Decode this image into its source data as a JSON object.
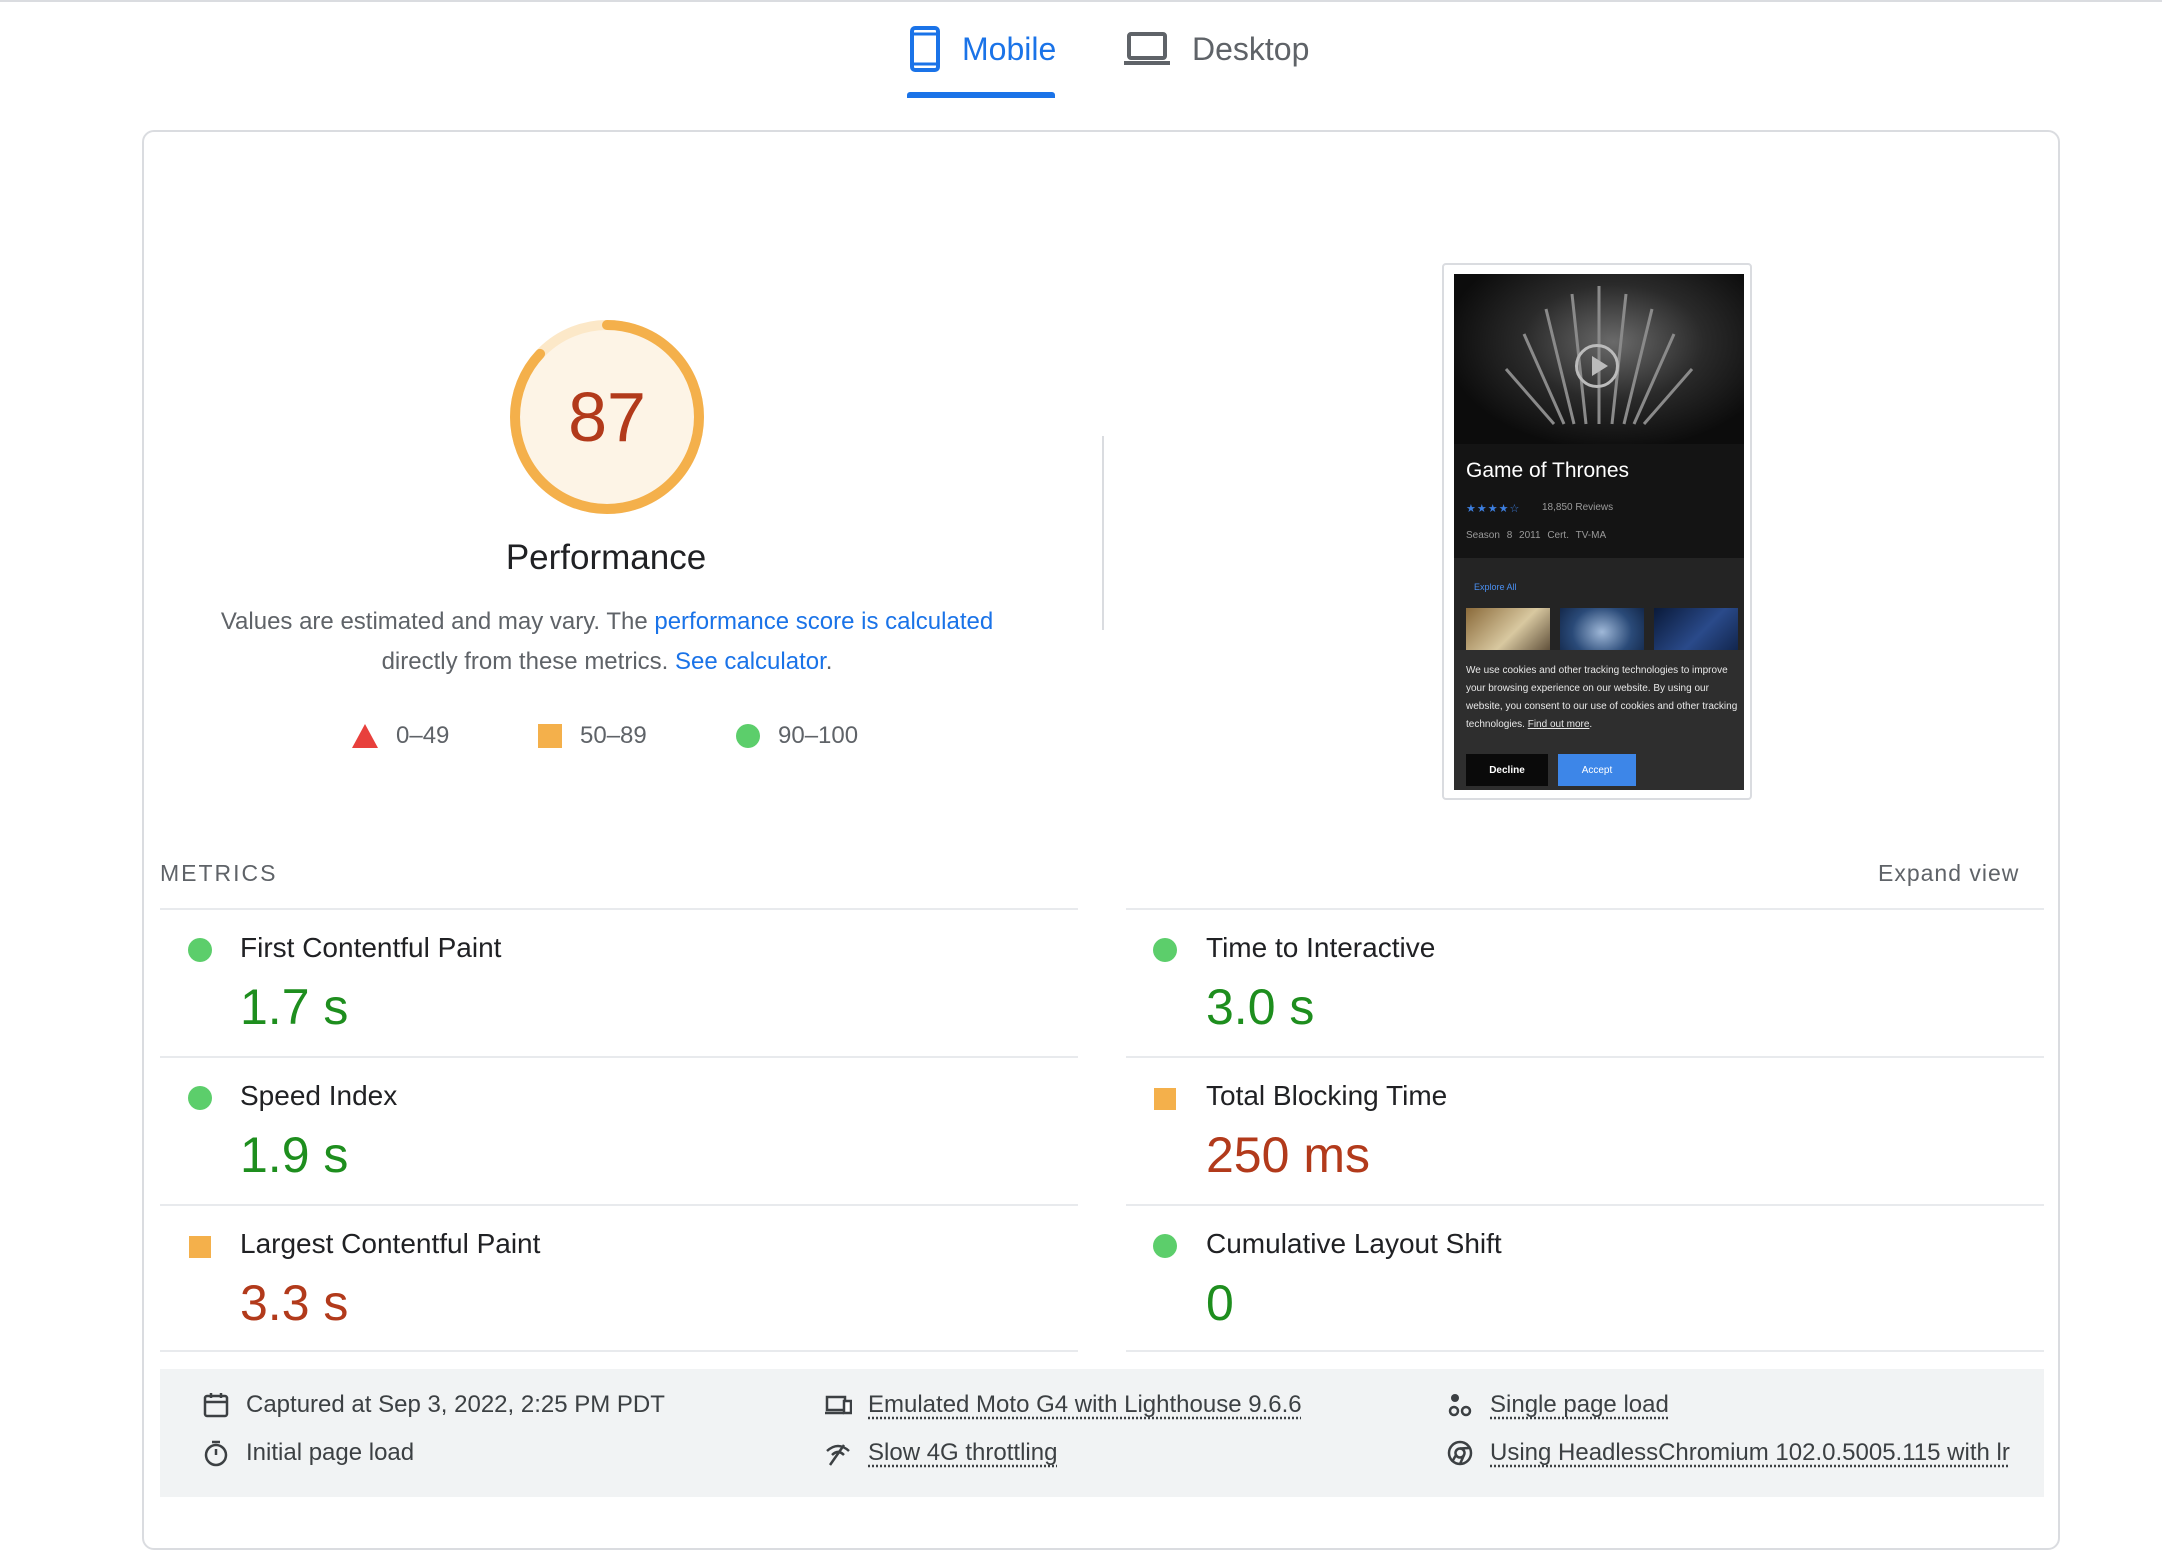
{
  "tabs": [
    {
      "label": "Mobile",
      "active": true,
      "icon": "smartphone-icon"
    },
    {
      "label": "Desktop",
      "active": false,
      "icon": "laptop-icon"
    }
  ],
  "performance": {
    "score": "87",
    "title": "Performance",
    "desc_1": "Values are estimated and may vary. The ",
    "desc_link_1": "performance score is calculated",
    "desc_2": " directly from these metrics. ",
    "desc_link_2": "See calculator",
    "desc_3": "."
  },
  "legend": [
    {
      "label": "0–49",
      "shape": "triangle",
      "color": "#e8403c"
    },
    {
      "label": "50–89",
      "shape": "square",
      "color": "#f4b04b"
    },
    {
      "label": "90–100",
      "shape": "circle",
      "color": "#5cce6b"
    }
  ],
  "screenshot": {
    "title": "Game of Thrones",
    "stars": "★★★★☆",
    "reviews": "18,850 Reviews",
    "season": "Season 8  2011  Cert. TV-MA",
    "explore": "Explore All",
    "cookie_text": "We use cookies and other tracking technologies to improve your browsing experience on our website. By using our website, you consent to our use of cookies and other tracking technologies.",
    "cookie_link": "Find out more",
    "decline": "Decline",
    "accept": "Accept"
  },
  "metrics": {
    "heading": "METRICS",
    "expand": "Expand view",
    "items": [
      {
        "label": "First Contentful Paint",
        "value": "1.7 s",
        "status": "good"
      },
      {
        "label": "Time to Interactive",
        "value": "3.0 s",
        "status": "good"
      },
      {
        "label": "Speed Index",
        "value": "1.9 s",
        "status": "good"
      },
      {
        "label": "Total Blocking Time",
        "value": "250 ms",
        "status": "average"
      },
      {
        "label": "Largest Contentful Paint",
        "value": "3.3 s",
        "status": "average"
      },
      {
        "label": "Cumulative Layout Shift",
        "value": "0",
        "status": "good"
      }
    ]
  },
  "footer": {
    "captured": "Captured at Sep 3, 2022, 2:25 PM PDT",
    "initial": "Initial page load",
    "emulated": "Emulated Moto G4 with Lighthouse 9.6.6",
    "throttling": "Slow 4G throttling",
    "single": "Single page load",
    "browser": "Using HeadlessChromium 102.0.5005.115 with lr"
  },
  "colors": {
    "accent": "#1a73e8",
    "good": "#5cce6b",
    "average": "#f4b04b",
    "poor": "#e8403c",
    "score_text": "#b23a1b"
  }
}
